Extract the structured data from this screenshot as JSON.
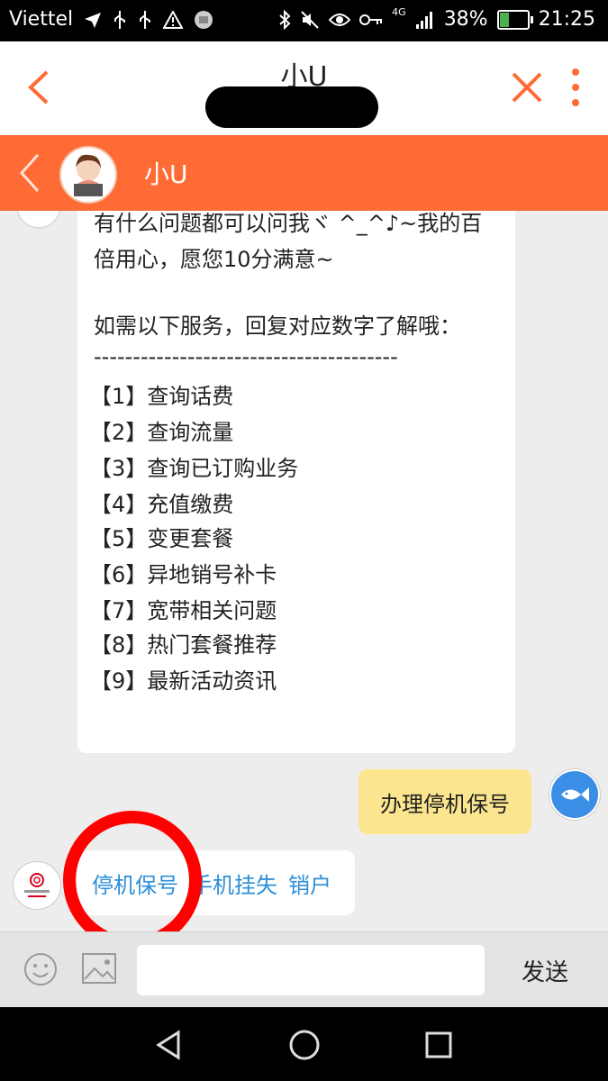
{
  "status_bar": {
    "carrier": "Viettel",
    "network": "4G",
    "battery": "38%",
    "battery_level": 0.38,
    "time": "21:25"
  },
  "top_bar": {
    "title": "小U"
  },
  "chat_header": {
    "name": "小U"
  },
  "bot_message": {
    "lines": [
      "有什么问题都可以问我ヾ ^_^♪~我的百",
      "倍用心，愿您10分满意~",
      "",
      "如需以下服务，回复对应数字了解哦：",
      "---------------------------------------",
      "【1】查询话费",
      "【2】查询流量",
      "【3】查询已订购业务",
      "【4】充值缴费",
      "【5】变更套餐",
      "【6】异地销号补卡",
      "【7】宽带相关问题",
      "【8】热门套餐推荐",
      "【9】最新活动资讯"
    ]
  },
  "user_message": {
    "text": "办理停机保号"
  },
  "quick_links": {
    "items": [
      "停机保号",
      "手机挂失",
      "销户"
    ]
  },
  "input_bar": {
    "value": "",
    "send_label": "发送"
  },
  "colors": {
    "accent_orange": "#ff6b35",
    "user_bubble": "#fbe58e",
    "link_blue": "#2c8fd8",
    "highlight_ring": "#ff0000"
  }
}
